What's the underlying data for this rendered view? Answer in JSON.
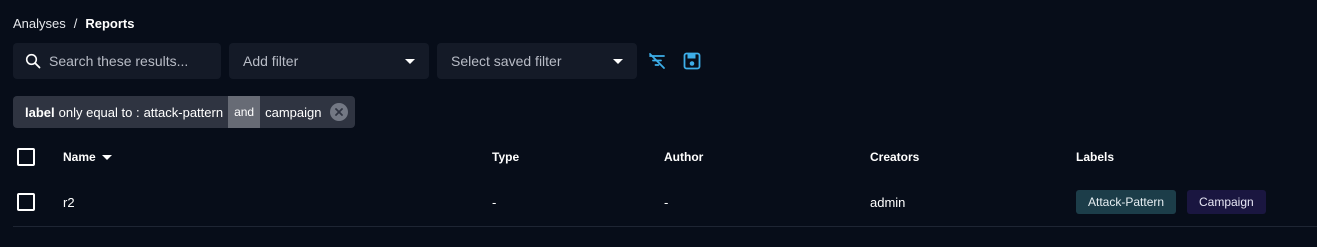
{
  "breadcrumb": {
    "parent": "Analyses",
    "separator": "/",
    "current": "Reports"
  },
  "toolbar": {
    "search_placeholder": "Search these results...",
    "add_filter_label": "Add filter",
    "saved_filter_label": "Select saved filter",
    "icons": {
      "search": "search-icon",
      "clear": "filter-off-icon",
      "save": "save-icon"
    }
  },
  "active_filter": {
    "key": "label",
    "operator": "only equal to :",
    "value1": "attack-pattern",
    "connector": "and",
    "value2": "campaign"
  },
  "table": {
    "columns": {
      "name": "Name",
      "type": "Type",
      "author": "Author",
      "creators": "Creators",
      "labels": "Labels"
    },
    "rows": [
      {
        "name": "r2",
        "type": "-",
        "author": "-",
        "creators": "admin",
        "labels": [
          "Attack-Pattern",
          "Campaign"
        ]
      }
    ]
  },
  "colors": {
    "background": "#070d19",
    "accent": "#3daee9",
    "label_attack_pattern": "#1c3d49",
    "label_campaign": "#1a1640"
  }
}
